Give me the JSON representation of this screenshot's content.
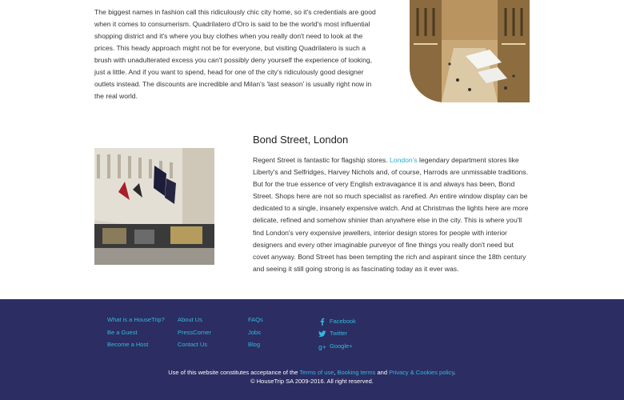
{
  "article": {
    "milan_paragraph": "The biggest names in fashion call this ridiculously chic city home, so it's credentials are good when it comes to consumerism. Quadrilatero d'Oro is said to be the world's most influential shopping district and it's where you buy clothes when you really don't need to look at the prices. This heady approach might not be for everyone, but visiting Quadrilatero is such a brush with unadulterated excess you can't possibly deny yourself the experience of looking, just a little. And if you want to spend, head for one of the city's ridiculously good designer outlets instead. The discounts are incredible and Milan's 'last season' is usually right now in the real world.",
    "london_heading": "Bond Street, London",
    "london_before_link": "Regent Street is fantastic for flagship stores. ",
    "london_link": "London's",
    "london_after_link": " legendary department stores like Liberty's and Selfridges, Harvey Nichols and, of course, Harrods are unmissable traditions. But for the true essence of very English extravagance it is and always has been, Bond Street. Shops here are not so much specialist as rarefied. An entire window display can be dedicated to a single, insanely expensive watch. And at Christmas the lights here are more delicate, refined and somehow shinier than anywhere else in the city. This is where you'll find London's very expensive jewellers, interior design stores for people with interior designers and every other imaginable purveyor of fine things you really don't need but covet anyway. Bond Street has been tempting the rich and aspirant since the 18th century and seeing it still going strong is as fascinating today as it ever was."
  },
  "footer": {
    "col1": [
      "What is a HouseTrip?",
      "Be a Guest",
      "Become a Host"
    ],
    "col2": [
      "About Us",
      "PressCorner",
      "Contact Us"
    ],
    "col3": [
      "FAQs",
      "Jobs",
      "Blog"
    ],
    "social": [
      {
        "label": "Facebook",
        "icon": "facebook-icon"
      },
      {
        "label": "Twitter",
        "icon": "twitter-icon"
      },
      {
        "label": "Google+",
        "icon": "google-plus-icon"
      }
    ],
    "legal_prefix": "Use of this website constitutes acceptance of the ",
    "terms_link": "Terms of use",
    "sep1": ", ",
    "booking_link": "Booking terms",
    "sep2": " and ",
    "privacy_link": "Privacy & Cookies policy",
    "legal_suffix": ".",
    "copyright": "© HouseTrip SA 2009-2016. All right reserved."
  },
  "colors": {
    "footer_bg": "#2c2d62",
    "link": "#33b9dd"
  }
}
